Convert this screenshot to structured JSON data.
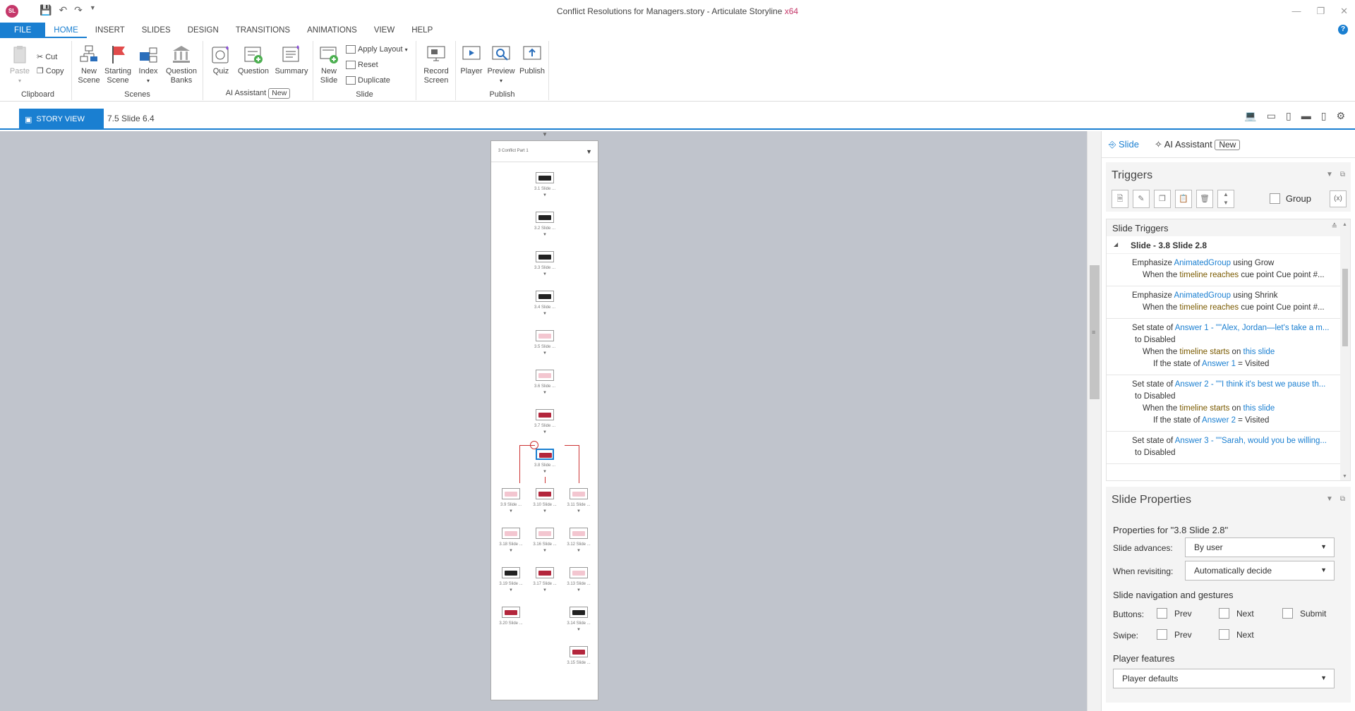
{
  "app": {
    "logo": "SL",
    "title": "Conflict Resolutions for Managers.story -  Articulate Storyline",
    "arch": "x64"
  },
  "ribbon_tabs": [
    "FILE",
    "HOME",
    "INSERT",
    "SLIDES",
    "DESIGN",
    "TRANSITIONS",
    "ANIMATIONS",
    "VIEW",
    "HELP"
  ],
  "ribbon": {
    "clipboard": {
      "paste": "Paste",
      "cut": "Cut",
      "copy": "Copy",
      "label": "Clipboard"
    },
    "scenes": {
      "new_scene": "New Scene",
      "starting_scene": "Starting Scene",
      "index": "Index",
      "question_banks": "Question Banks",
      "label": "Scenes"
    },
    "ai": {
      "quiz": "Quiz",
      "question": "Question",
      "summary": "Summary",
      "label": "AI Assistant",
      "badge": "New"
    },
    "slide": {
      "new_slide": "New Slide",
      "apply_layout": "Apply Layout",
      "reset": "Reset",
      "duplicate": "Duplicate",
      "label": "Slide"
    },
    "record": {
      "record_screen": "Record Screen"
    },
    "publish": {
      "player": "Player",
      "preview": "Preview",
      "publish": "Publish",
      "label": "Publish"
    }
  },
  "viewbar": {
    "story_view": "STORY VIEW",
    "breadcrumb": "7.5 Slide 6.4"
  },
  "scene": {
    "title": "3 Conflict Part 1",
    "nodes": [
      {
        "label": "3.1 Slide ...",
        "style": "dark"
      },
      {
        "label": "3.2 Slide ...",
        "style": "dark"
      },
      {
        "label": "3.3 Slide ...",
        "style": "dark"
      },
      {
        "label": "3.4 Slide ...",
        "style": "dark"
      },
      {
        "label": "3.5 Slide ...",
        "style": "pink"
      },
      {
        "label": "3.6 Slide ...",
        "style": "pink"
      },
      {
        "label": "3.7 Slide ...",
        "style": "red"
      },
      {
        "label": "3.8 Slide ...",
        "style": "red"
      },
      {
        "label": "3.9 Slide ...",
        "style": "pink"
      },
      {
        "label": "3.10 Slide ...",
        "style": "red"
      },
      {
        "label": "3.11 Slide ...",
        "style": "pink"
      },
      {
        "label": "3.18 Slide ...",
        "style": "pink"
      },
      {
        "label": "3.16 Slide ...",
        "style": "pink"
      },
      {
        "label": "3.12 Slide ...",
        "style": "pink"
      },
      {
        "label": "3.19 Slide ...",
        "style": "dark"
      },
      {
        "label": "3.17 Slide ...",
        "style": "red"
      },
      {
        "label": "3.13 Slide ...",
        "style": "pink"
      },
      {
        "label": "3.20 Slide ...",
        "style": "red"
      },
      {
        "label": "3.14 Slide ...",
        "style": "dark"
      },
      {
        "label": "3.15 Slide ...",
        "style": "red"
      }
    ]
  },
  "panel": {
    "tabs": {
      "slide": "Slide",
      "ai": "AI Assistant",
      "badge": "New"
    },
    "triggers": {
      "title": "Triggers",
      "group": "Group",
      "slide_triggers": "Slide Triggers",
      "slide_group": "Slide - 3.8 Slide 2.8",
      "items": [
        {
          "l1": [
            "Emphasize ",
            "AnimatedGroup",
            " using Grow"
          ],
          "l2": [
            "When the ",
            "timeline reaches",
            " cue point Cue point #..."
          ]
        },
        {
          "l1": [
            "Emphasize ",
            "AnimatedGroup",
            " using Shrink"
          ],
          "l2": [
            "When the ",
            "timeline reaches",
            " cue point Cue point #..."
          ]
        },
        {
          "l1": [
            "Set state of ",
            "Answer 1 - \"\"Alex, Jordan—let's take a m..."
          ],
          "l1b": "to Disabled",
          "l2": [
            "When the ",
            "timeline starts",
            " on ",
            "this slide"
          ],
          "l3": [
            "If the state of ",
            "Answer 1",
            " = Visited"
          ]
        },
        {
          "l1": [
            "Set state of ",
            "Answer 2 - \"\"I think it's best we pause th..."
          ],
          "l1b": "to Disabled",
          "l2": [
            "When the ",
            "timeline starts",
            " on ",
            "this slide"
          ],
          "l3": [
            "If the state of ",
            "Answer 2",
            " = Visited"
          ]
        },
        {
          "l1": [
            "Set state of ",
            "Answer 3 - \"\"Sarah, would you be willing..."
          ],
          "l1b": "to Disabled"
        }
      ]
    },
    "properties": {
      "title": "Slide Properties",
      "for": "Properties for \"3.8 Slide 2.8\"",
      "advances_label": "Slide advances:",
      "advances_value": "By user",
      "revisit_label": "When revisiting:",
      "revisit_value": "Automatically decide",
      "nav_title": "Slide navigation and gestures",
      "buttons_label": "Buttons:",
      "swipe_label": "Swipe:",
      "prev": "Prev",
      "next": "Next",
      "submit": "Submit",
      "player_title": "Player features",
      "player_value": "Player defaults"
    }
  },
  "colors": {
    "accent": "#1a7fd1",
    "brand": "#c5386a",
    "canvas": "#c0c4cc"
  }
}
